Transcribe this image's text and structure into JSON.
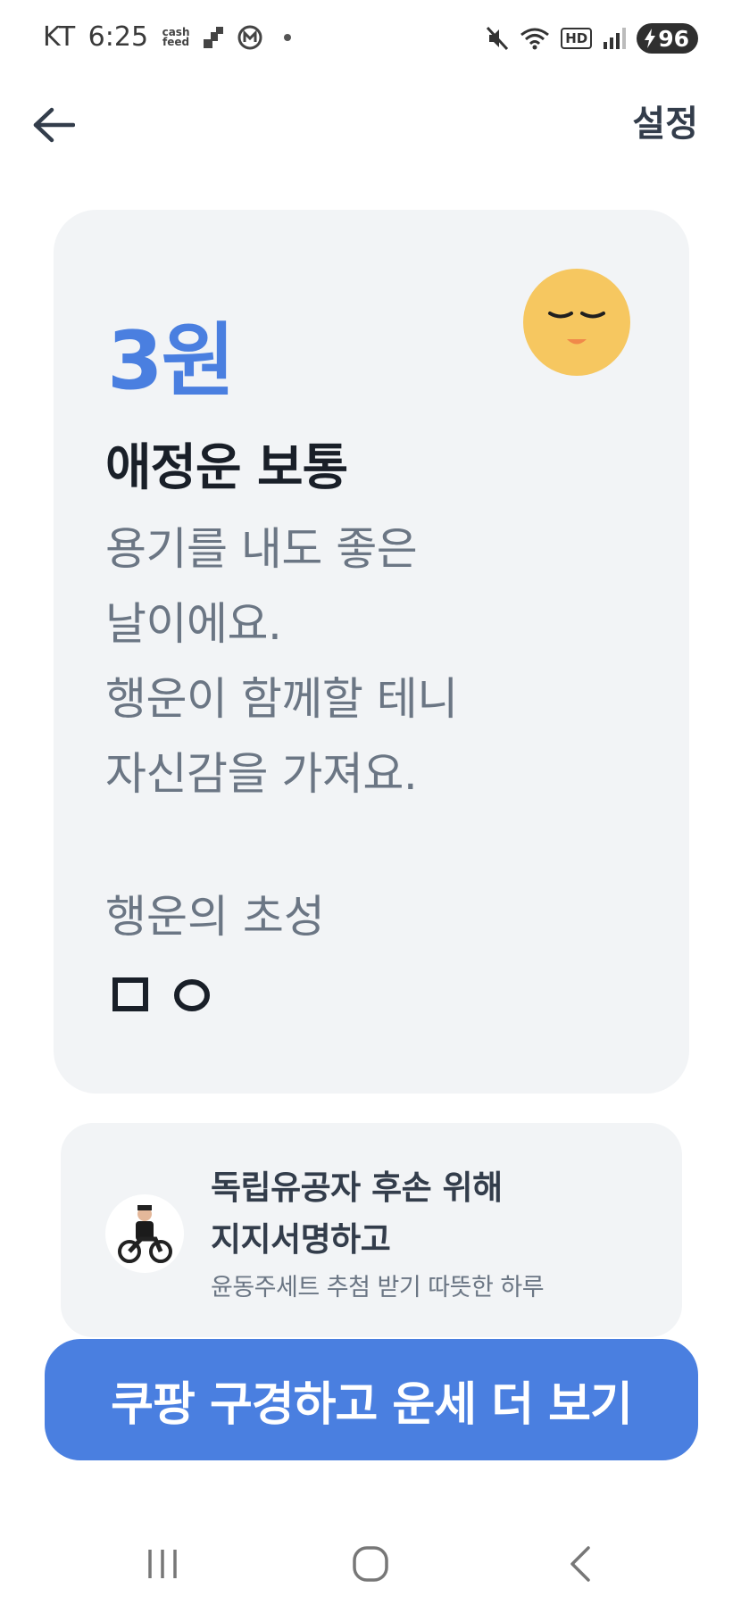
{
  "status_bar": {
    "carrier": "KT",
    "time": "6:25",
    "notification_icons": [
      "cashfeed-icon",
      "signal-bars-icon",
      "m-circle-icon"
    ],
    "cashfeed_label_line1": "cash",
    "cashfeed_label_line2": "feed",
    "status_icons": [
      "mute-icon",
      "wifi-icon",
      "hd-icon",
      "cell-signal-icon"
    ],
    "hd_label": "HD",
    "battery_level": "96"
  },
  "header": {
    "back_icon": "arrow-left-icon",
    "settings_label": "설정"
  },
  "fortune": {
    "amount": "3원",
    "mood_icon": "sleepy-face-icon",
    "title": "애정운 보통",
    "message_lines": [
      "용기를 내도 좋은",
      "날이에요.",
      "행운이 함께할 테니",
      "자신감을 가져요."
    ],
    "initials_label": "행운의 초성",
    "initials": [
      "ㅁ",
      "ㅇ"
    ]
  },
  "ad": {
    "avatar_icon": "motorcycle-rider-icon",
    "title_lines": [
      "독립유공자 후손 위해",
      "지지서명하고"
    ],
    "subtitle": "윤동주세트 추첨 받기 따뜻한 하루"
  },
  "cta": {
    "label": "쿠팡 구경하고 운세 더 보기"
  },
  "nav_bar": {
    "items": [
      "recent-apps-icon",
      "home-icon",
      "back-icon"
    ]
  },
  "colors": {
    "accent": "#4a7fe0",
    "card_bg": "#f2f4f6",
    "title_text": "#191f28",
    "body_text": "#6b7684",
    "emoji_yellow": "#f6c760"
  }
}
